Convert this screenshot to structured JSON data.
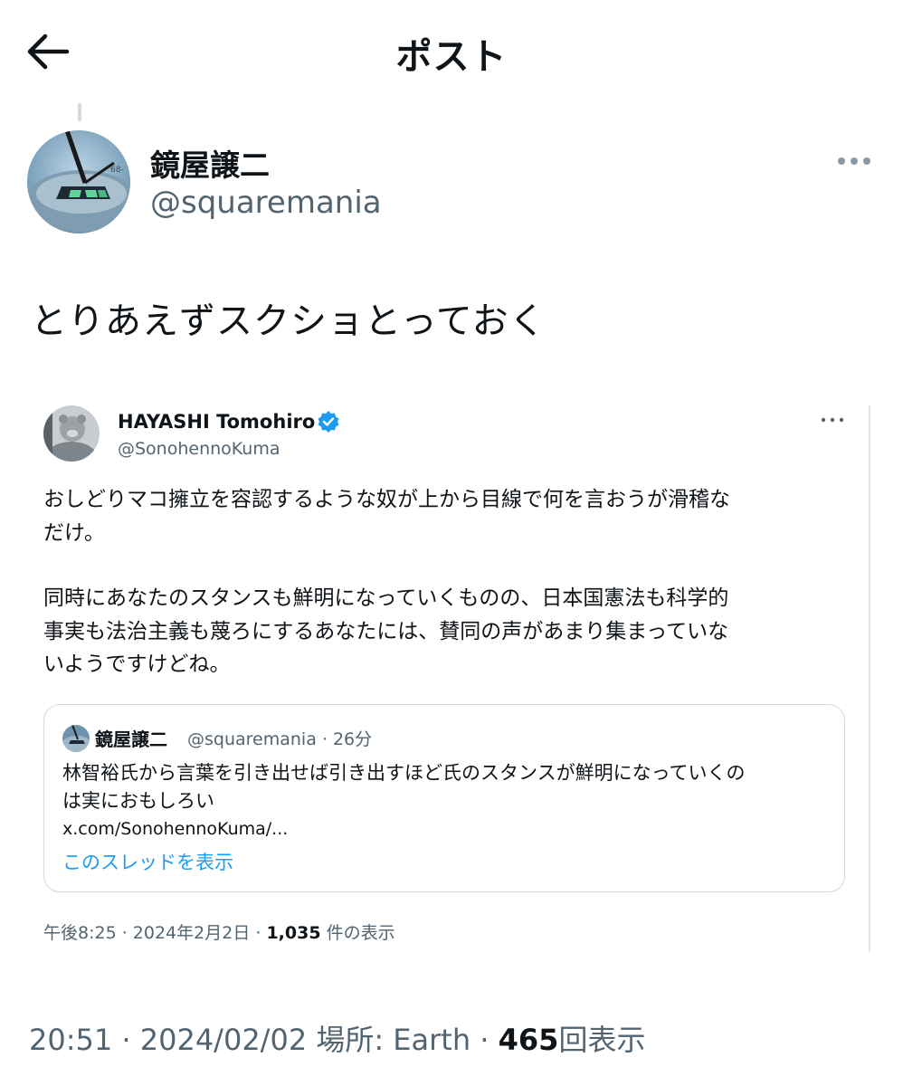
{
  "header": {
    "title": "ポスト"
  },
  "author": {
    "name": "鏡屋譲二",
    "handle": "@squaremania"
  },
  "post": {
    "text": "とりあえずスクショとっておく"
  },
  "embedded": {
    "name": "HAYASHI Tomohiro",
    "handle": "@SonohennoKuma",
    "body_lines": [
      "おしどりマコ擁立を容認するような奴が上から目線で何を言おうが滑稽な",
      "だけ。",
      "",
      "同時にあなたのスタンスも鮮明になっていくものの、日本国憲法も科学的",
      "事実も法治主義も蔑ろにするあなたには、賛同の声があまり集まっていな",
      "いようですけどね。"
    ],
    "quote": {
      "name": "鏡屋譲二",
      "meta": "@squaremania · 26分",
      "body_lines": [
        "林智裕氏から言葉を引き出せば引き出すほど氏のスタンスが鮮明になっていくの",
        "は実におもしろい"
      ],
      "link": "x.com/SonohennoKuma/...",
      "thread_label": "このスレッドを表示"
    },
    "meta_time": "午後8:25 · 2024年2月2日 · ",
    "meta_views_count": "1,035",
    "meta_views_label": " 件の表示"
  },
  "meta": {
    "time": "20:51 · 2024/02/02 場所: Earth · ",
    "views_count": "465",
    "views_label": "回表示"
  },
  "colors": {
    "text": "#0f1419",
    "secondary": "#536471",
    "accent": "#1d9bf0",
    "border": "#cfd9de"
  },
  "icons": [
    "back-arrow-icon",
    "more-icon",
    "verified-badge-icon"
  ]
}
